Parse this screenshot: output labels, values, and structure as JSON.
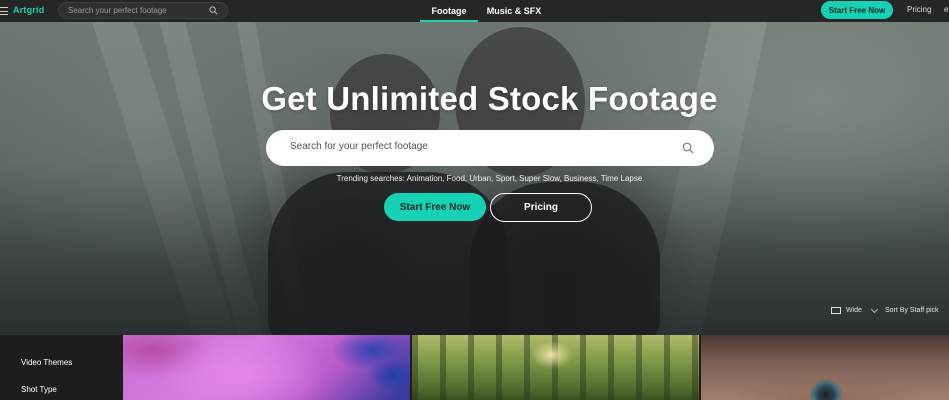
{
  "nav": {
    "logo": "Artgrid",
    "search_placeholder": "Search your perfect footage",
    "tabs": [
      {
        "label": "Footage",
        "active": true
      },
      {
        "label": "Music & SFX",
        "active": false
      }
    ],
    "cta_label": "Start Free Now",
    "pricing_label": "Pricing",
    "truncated_text": "e"
  },
  "hero": {
    "title": "Get Unlimited Stock Footage",
    "search_placeholder": "Search for your perfect footage",
    "trending": "Trending searches: Animation, Food, Urban, Sport, Super Slow, Business, Time Lapse",
    "cta_label": "Start Free Now",
    "pricing_label": "Pricing"
  },
  "controls": {
    "view_label": "Wide",
    "sort_label": "Sort By Staff pick"
  },
  "sidebar": {
    "items": [
      {
        "label": "Video Themes"
      },
      {
        "label": "Shot Type"
      }
    ]
  },
  "colors": {
    "accent": "#16d1b3",
    "topbar": "#262626",
    "background": "#1d1d1d"
  },
  "icons": [
    "menu-icon",
    "search-icon",
    "wide-view-icon",
    "chevron-down-icon"
  ]
}
